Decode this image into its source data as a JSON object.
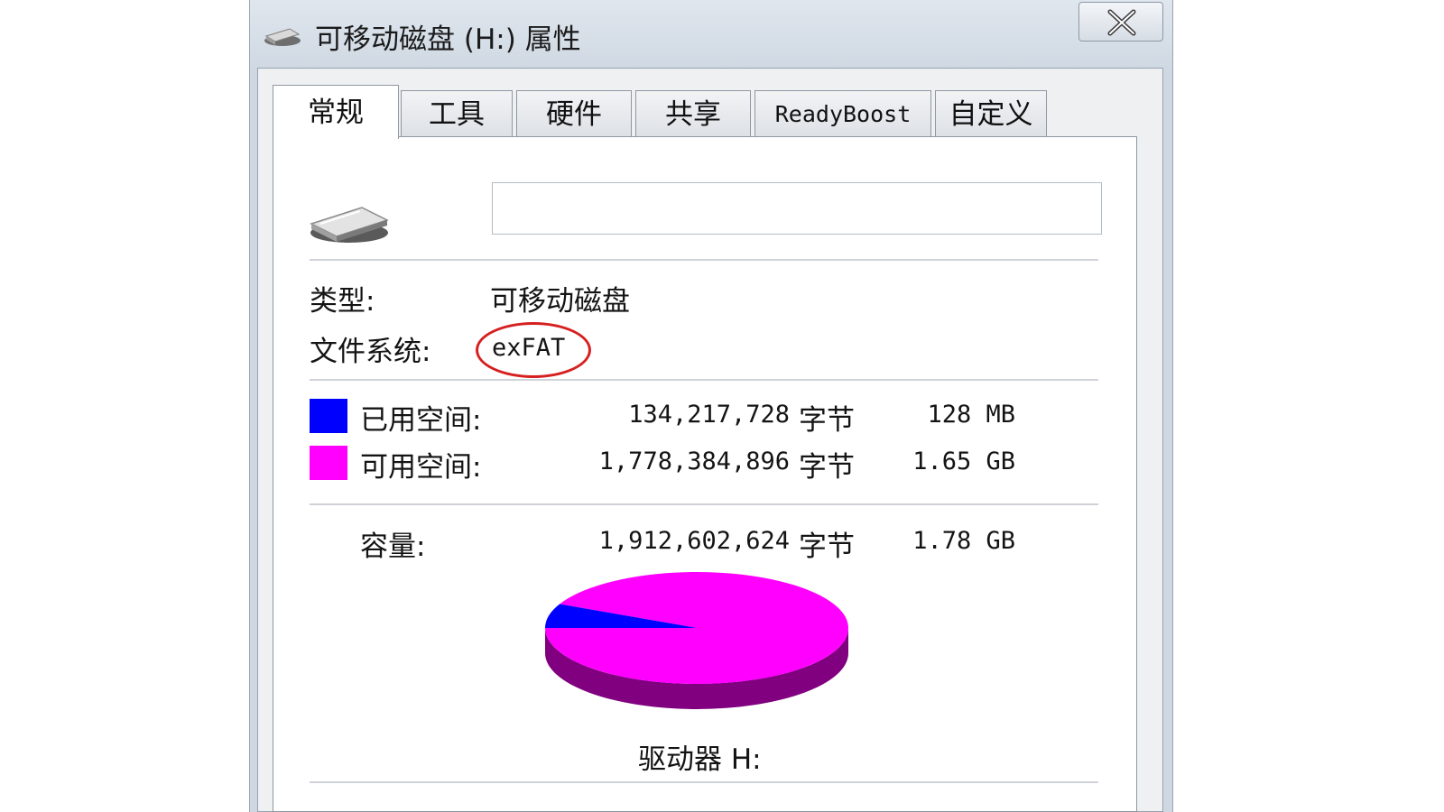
{
  "window": {
    "title": "可移动磁盘 (H:) 属性",
    "close_label": "✕"
  },
  "tabs": [
    {
      "label": "常规",
      "active": true
    },
    {
      "label": "工具"
    },
    {
      "label": "硬件"
    },
    {
      "label": "共享"
    },
    {
      "label": "ReadyBoost"
    },
    {
      "label": "自定义"
    }
  ],
  "general": {
    "volume_name_value": "",
    "type_label": "类型:",
    "type_value": "可移动磁盘",
    "fs_label": "文件系统:",
    "fs_value": "exFAT",
    "used": {
      "label": "已用空间:",
      "bytes": "134,217,728",
      "unit": "字节",
      "size": "128 MB",
      "color": "#0000ff"
    },
    "free": {
      "label": "可用空间:",
      "bytes": "1,778,384,896",
      "unit": "字节",
      "size": "1.65 GB",
      "color": "#ff00ff"
    },
    "capacity": {
      "label": "容量:",
      "bytes": "1,912,602,624",
      "unit": "字节",
      "size": "1.78 GB"
    },
    "drive_label": "驱动器 H:",
    "pie": {
      "used_fraction": 0.0702,
      "used_color": "#0000ff",
      "free_color": "#ff00ff",
      "side_color": "#80007f"
    }
  },
  "icons": {
    "title": "removable-drive-icon",
    "drive": "removable-drive-icon",
    "close": "close-icon"
  },
  "accent": {
    "highlight_oval": "#d62020"
  }
}
